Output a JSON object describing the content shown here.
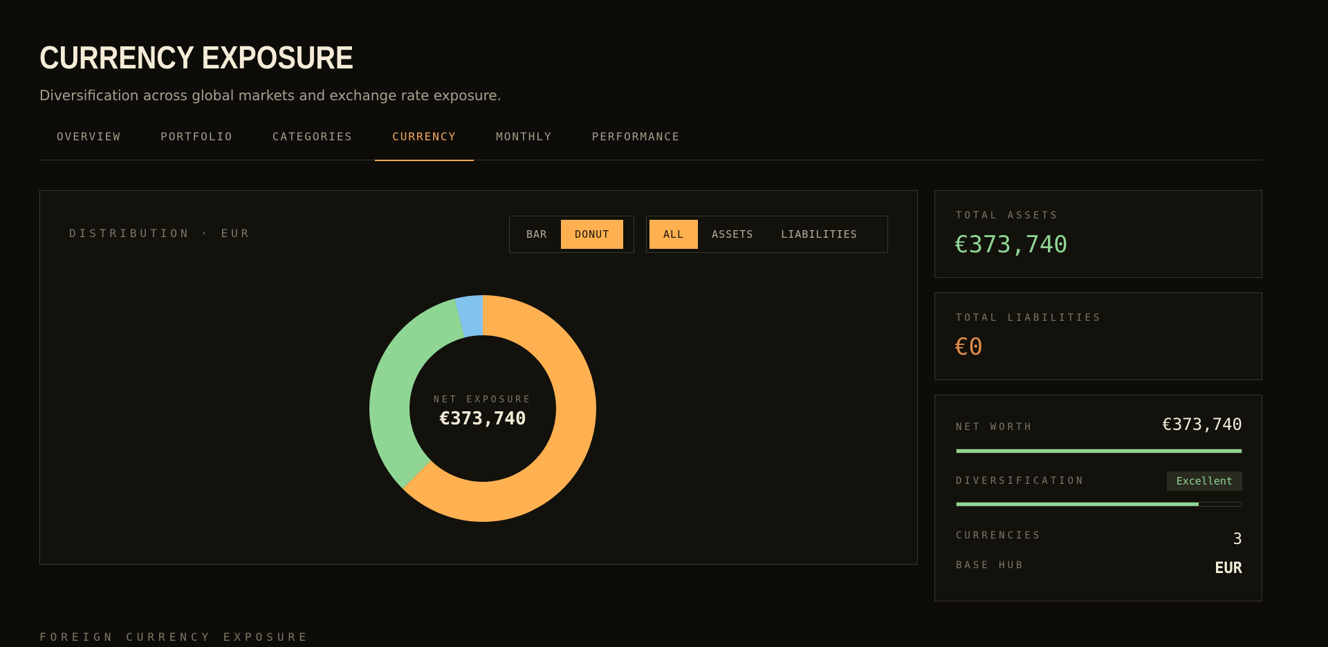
{
  "header": {
    "title": "CURRENCY EXPOSURE",
    "subtitle": "Diversification across global markets and exchange rate exposure."
  },
  "tabs": [
    {
      "label": "OVERVIEW",
      "active": false
    },
    {
      "label": "PORTFOLIO",
      "active": false
    },
    {
      "label": "CATEGORIES",
      "active": false
    },
    {
      "label": "CURRENCY",
      "active": true
    },
    {
      "label": "MONTHLY",
      "active": false
    },
    {
      "label": "PERFORMANCE",
      "active": false
    }
  ],
  "distribution": {
    "label": "DISTRIBUTION · EUR",
    "chart_type_options": [
      {
        "label": "BAR",
        "selected": false
      },
      {
        "label": "DONUT",
        "selected": true
      }
    ],
    "filter_options": [
      {
        "label": "ALL",
        "selected": true
      },
      {
        "label": "ASSETS",
        "selected": false
      },
      {
        "label": "LIABILITIES",
        "selected": false
      }
    ],
    "center_label": "NET EXPOSURE",
    "center_value": "€373,740"
  },
  "chart_data": {
    "type": "pie",
    "donut": true,
    "slices": [
      {
        "value": 62.5,
        "color": "#ffb152"
      },
      {
        "value": 33.5,
        "color": "#8fd694"
      },
      {
        "value": 4.0,
        "color": "#82c3ee"
      }
    ]
  },
  "cards": {
    "total_assets": {
      "label": "TOTAL ASSETS",
      "value": "€373,740",
      "color": "#8fd694"
    },
    "total_liabilities": {
      "label": "TOTAL LIABILITIES",
      "value": "€0",
      "color": "#e08c4a"
    },
    "net": {
      "net_worth_label": "NET WORTH",
      "net_worth_value": "€373,740",
      "net_worth_fill": 1.0,
      "diversification_label": "DIVERSIFICATION",
      "diversification_badge": "Excellent",
      "diversification_fill": 0.85,
      "currencies_label": "CURRENCIES",
      "currencies_value": "3",
      "base_hub_label": "BASE HUB",
      "base_hub_value": "EUR"
    }
  },
  "footer": {
    "section_label": "FOREIGN CURRENCY EXPOSURE"
  }
}
